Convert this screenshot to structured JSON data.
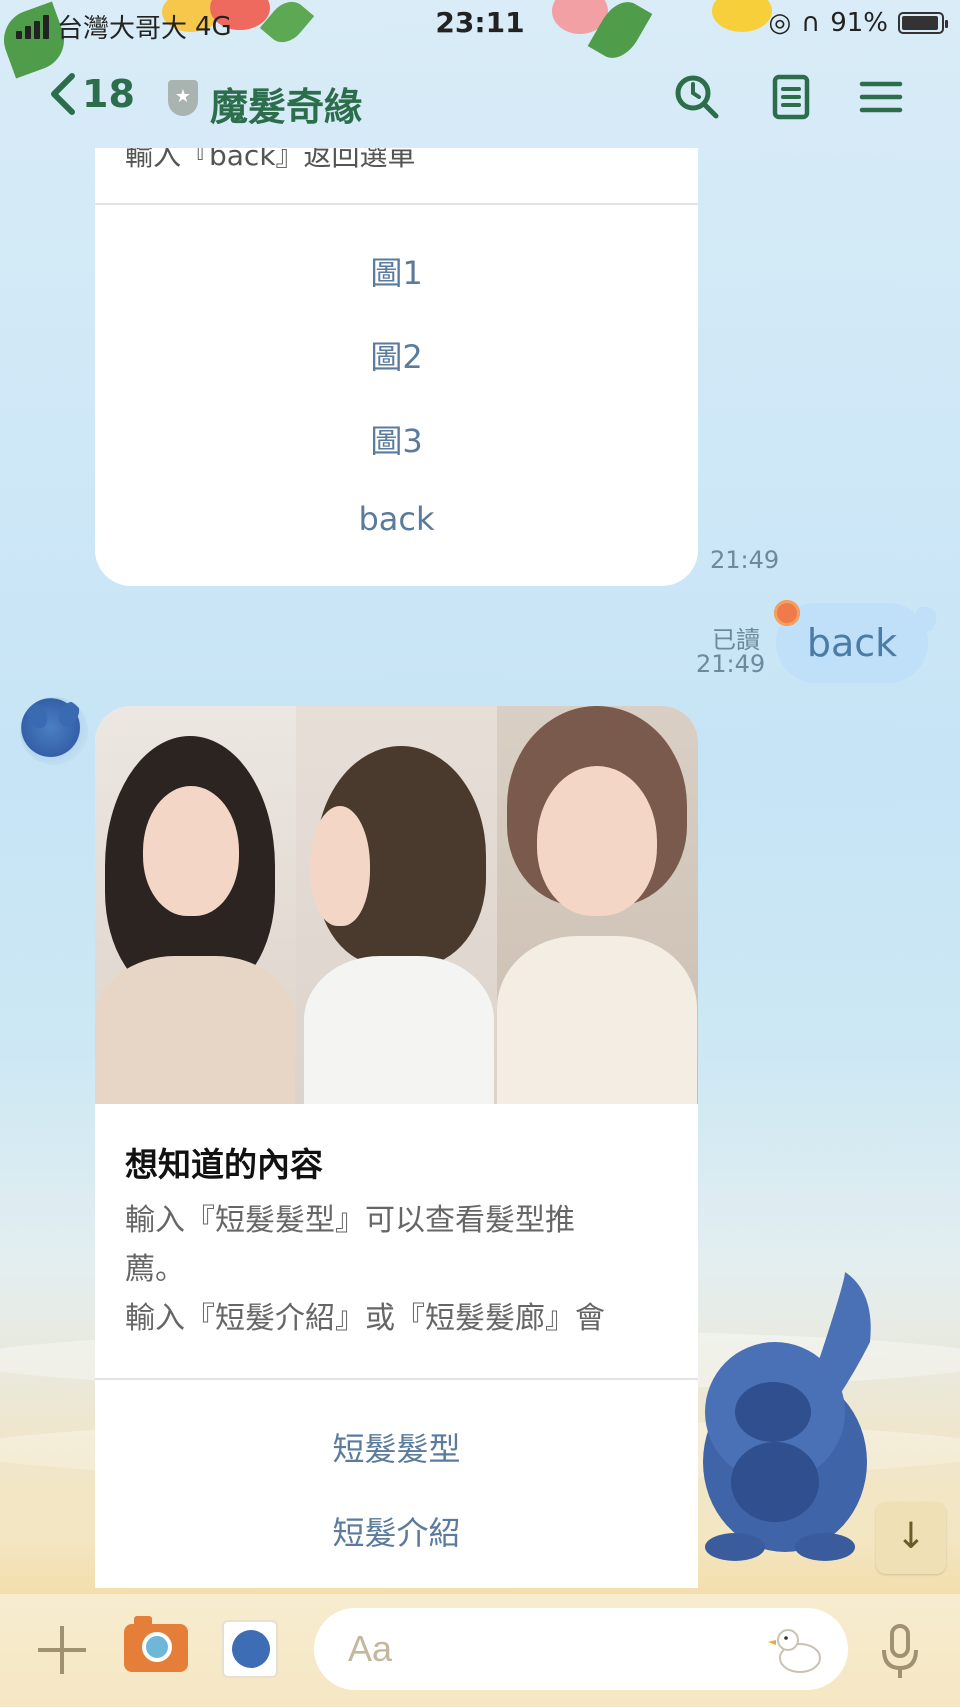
{
  "status_bar": {
    "carrier": "台灣大哥大",
    "network": "4G",
    "time": "23:11",
    "battery": "91%"
  },
  "header": {
    "back_count": "18",
    "chat_title": "魔髮奇緣"
  },
  "messages": {
    "card1": {
      "cut_text": "輸入『back』返回選單",
      "actions": [
        "圖1",
        "圖2",
        "圖3",
        "back"
      ],
      "time": "21:49"
    },
    "my_message": {
      "text": "back",
      "read_label": "已讀",
      "time": "21:49"
    },
    "card2": {
      "title": "想知道的內容",
      "desc_line1": "輸入『短髮髮型』可以查看髮型推",
      "desc_line2": "薦。",
      "desc_line3": "輸入『短髮介紹』或『短髮髮廊』會",
      "actions": [
        "短髮髮型",
        "短髮介紹"
      ]
    }
  },
  "input_bar": {
    "placeholder": "Aa"
  },
  "colors": {
    "header_green": "#2c6d4c",
    "action_blue": "#5b7b9e",
    "my_bubble": "#bfe0f8"
  }
}
